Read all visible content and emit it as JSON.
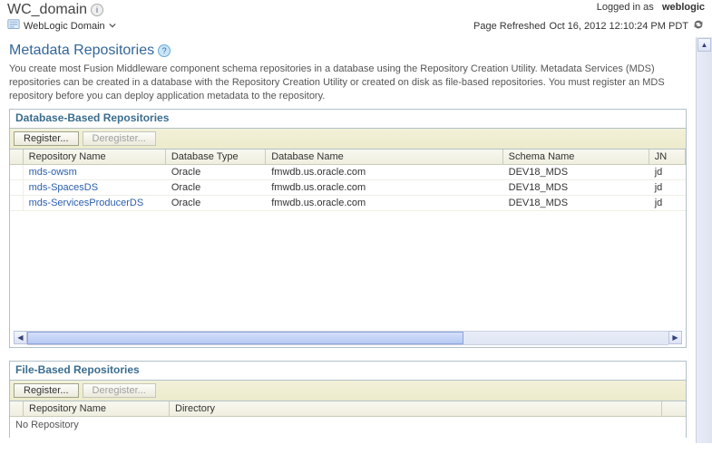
{
  "header": {
    "title": "WC_domain",
    "logged_in_as_label": "Logged in as",
    "user": "weblogic",
    "refresh_label": "Page Refreshed",
    "refresh_time": "Oct 16, 2012 12:10:24 PM PDT"
  },
  "breadcrumb": {
    "label": "WebLogic Domain"
  },
  "page": {
    "title": "Metadata Repositories",
    "intro": "You create most Fusion Middleware component schema repositories in a database using the Repository Creation Utility. Metadata Services (MDS) repositories can be created in a database with the Repository Creation Utility or created on disk as file-based repositories. You must register an MDS repository before you can deploy application metadata to the repository."
  },
  "db_panel": {
    "title": "Database-Based Repositories",
    "register_label": "Register...",
    "deregister_label": "Deregister...",
    "columns": {
      "c1": "Repository Name",
      "c2": "Database Type",
      "c3": "Database Name",
      "c4": "Schema Name",
      "c5": "JN"
    },
    "rows": [
      {
        "name": "mds-owsm",
        "dbtype": "Oracle",
        "dbname": "fmwdb.us.oracle.com",
        "schema": "DEV18_MDS",
        "jn": "jd"
      },
      {
        "name": "mds-SpacesDS",
        "dbtype": "Oracle",
        "dbname": "fmwdb.us.oracle.com",
        "schema": "DEV18_MDS",
        "jn": "jd"
      },
      {
        "name": "mds-ServicesProducerDS",
        "dbtype": "Oracle",
        "dbname": "fmwdb.us.oracle.com",
        "schema": "DEV18_MDS",
        "jn": "jd"
      }
    ]
  },
  "file_panel": {
    "title": "File-Based Repositories",
    "register_label": "Register...",
    "deregister_label": "Deregister...",
    "columns": {
      "c1": "Repository Name",
      "c2": "Directory"
    },
    "empty_text": "No Repository"
  }
}
